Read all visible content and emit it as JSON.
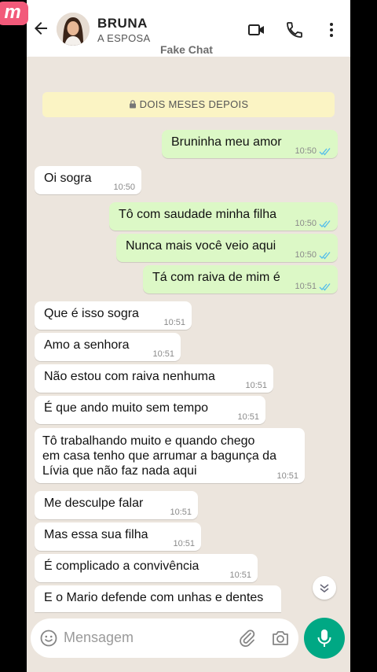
{
  "app": {
    "logo": "m",
    "watermark": "Fake Chat"
  },
  "header": {
    "contact_name": "BRUNA",
    "contact_status": "A ESPOSA",
    "icons": [
      "back-arrow-icon",
      "video-call-icon",
      "phone-icon",
      "more-vert-icon"
    ]
  },
  "banner": {
    "text": "DOIS MESES DEPOIS",
    "icon": "lock-icon"
  },
  "messages": [
    {
      "dir": "out",
      "text": "Bruninha meu amor",
      "time": "10:50",
      "read": true
    },
    {
      "dir": "in",
      "text": "Oi sogra",
      "time": "10:50"
    },
    {
      "dir": "out",
      "text": "Tô com saudade minha filha",
      "time": "10:50",
      "read": true
    },
    {
      "dir": "out",
      "text": "Nunca mais você veio aqui",
      "time": "10:50",
      "read": true
    },
    {
      "dir": "out",
      "text": "Tá com raiva de mim é",
      "time": "10:51",
      "read": true
    },
    {
      "dir": "in",
      "text": "Que é isso sogra",
      "time": "10:51"
    },
    {
      "dir": "in",
      "text": "Amo a senhora",
      "time": "10:51"
    },
    {
      "dir": "in",
      "text": "Não estou com raiva nenhuma",
      "time": "10:51"
    },
    {
      "dir": "in",
      "text": "É que ando muito sem tempo",
      "time": "10:51"
    },
    {
      "dir": "in",
      "lines": [
        "Tô trabalhando muito e quando chego",
        "em casa tenho que arrumar a bagunça da",
        "Lívia que não faz nada aqui"
      ],
      "time": "10:51"
    },
    {
      "dir": "in",
      "text": "Me desculpe falar",
      "time": "10:51"
    },
    {
      "dir": "in",
      "text": "Mas essa sua filha",
      "time": "10:51"
    },
    {
      "dir": "in",
      "text": "É complicado a convivência",
      "time": "10:51"
    },
    {
      "dir": "in",
      "text": "E o Mario defende com unhas e dentes",
      "time": ""
    }
  ],
  "composer": {
    "placeholder": "Mensagem",
    "icons": [
      "emoji-icon",
      "attach-icon",
      "camera-icon",
      "mic-icon",
      "scroll-down-icon"
    ]
  },
  "colors": {
    "outgoing": "#dcf8c6",
    "incoming": "#ffffff",
    "background": "#ece5dd",
    "accent": "#00a884",
    "read_ticks": "#53bdeb",
    "banner": "#fbf4c4"
  }
}
